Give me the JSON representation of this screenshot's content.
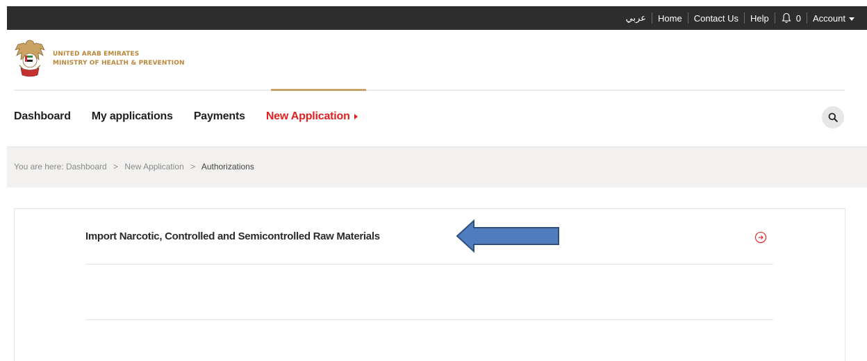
{
  "topbar": {
    "language": "عربي",
    "home": "Home",
    "contact": "Contact Us",
    "help": "Help",
    "notification_count": "0",
    "account": "Account"
  },
  "logo": {
    "line1": "UNITED ARAB EMIRATES",
    "line2": "MINISTRY OF HEALTH & PREVENTION"
  },
  "nav": {
    "items": [
      {
        "label": "Dashboard"
      },
      {
        "label": "My applications"
      },
      {
        "label": "Payments"
      },
      {
        "label": "New Application"
      }
    ],
    "active_index": 3
  },
  "breadcrumb": {
    "prefix": "You are here:",
    "items": [
      "Dashboard",
      "New Application",
      "Authorizations"
    ],
    "separator": ">"
  },
  "content": {
    "rows": [
      {
        "title": "Import Narcotic, Controlled and Semicontrolled Raw Materials"
      }
    ]
  },
  "colors": {
    "accent": "#e2201f",
    "gold": "#b9873c",
    "topbar_bg": "#2d2d2d",
    "annotation_arrow": "#4f7dbd"
  },
  "icons": {
    "bell": "bell-icon",
    "search": "search-icon",
    "row_action": "arrow-right-circle-icon",
    "emblem": "uae-emblem-icon"
  }
}
